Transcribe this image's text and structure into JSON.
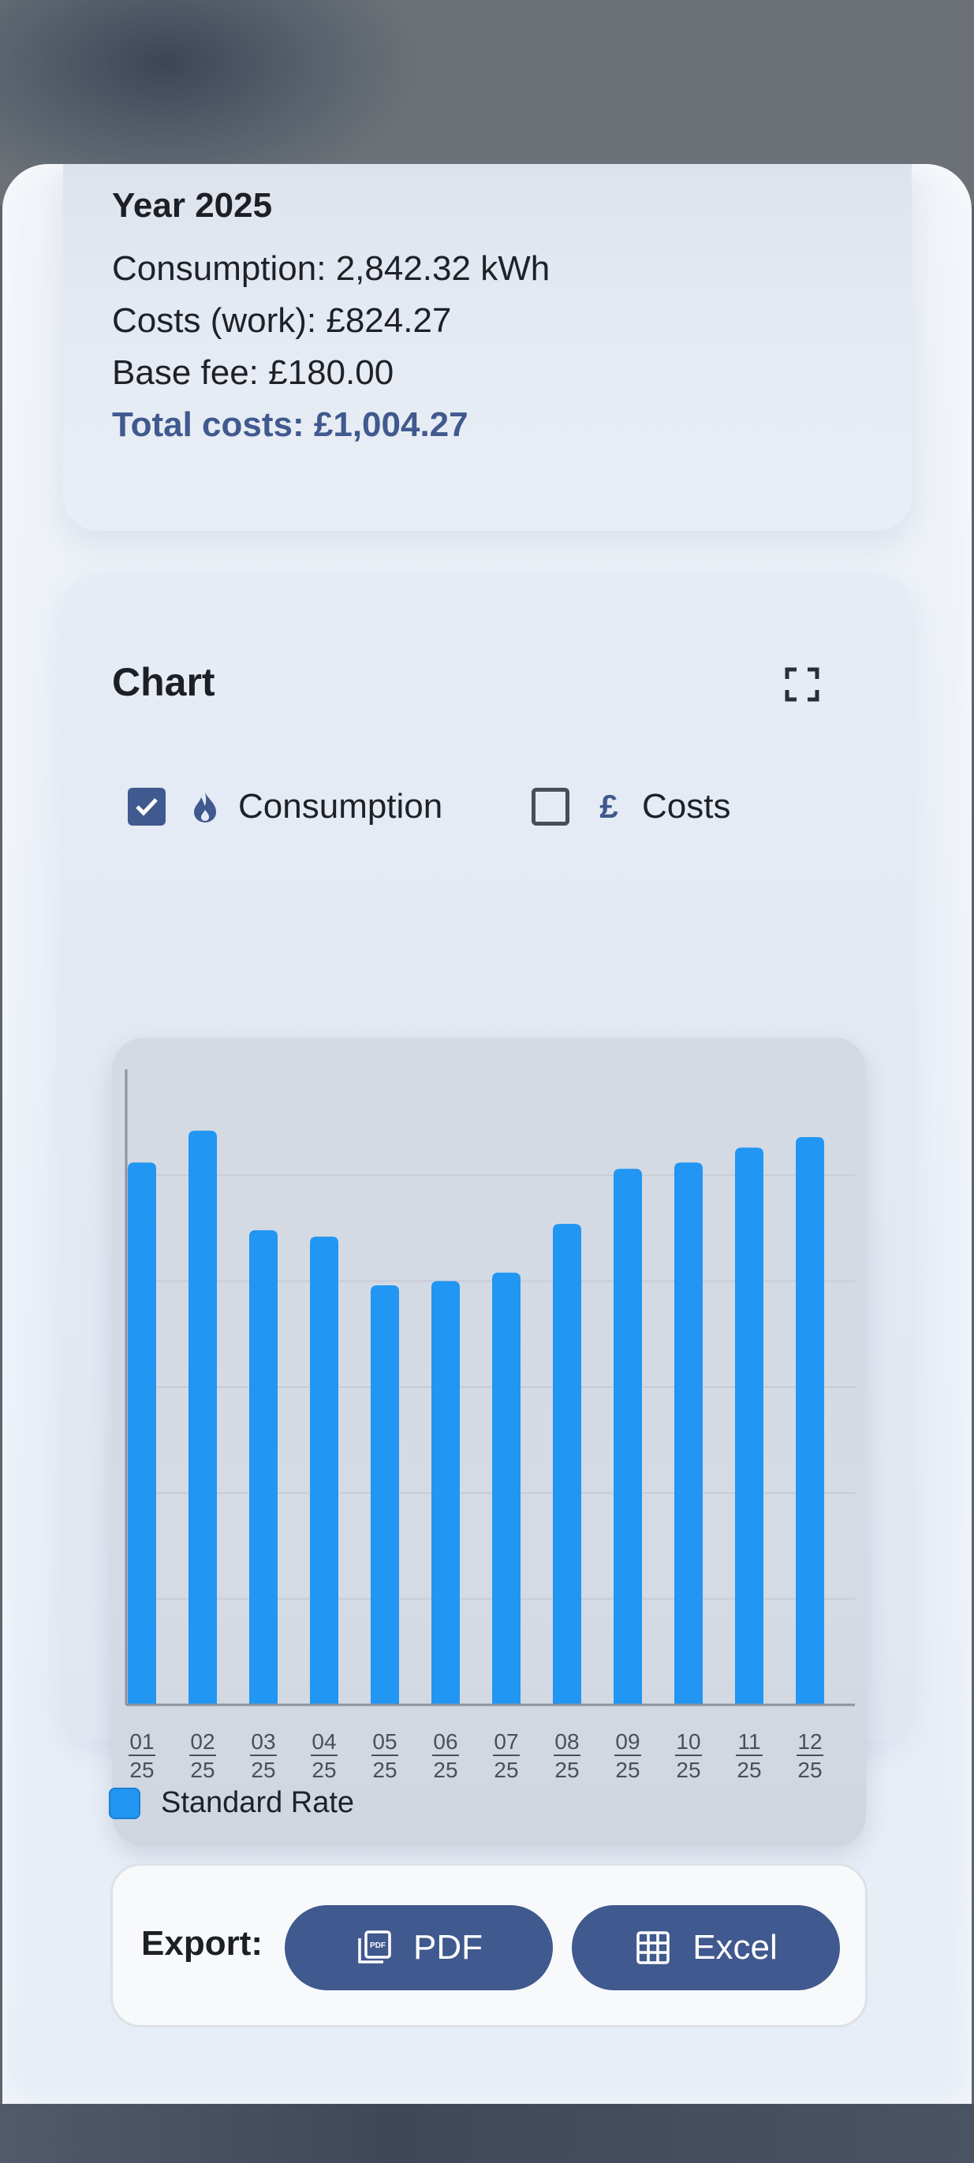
{
  "summary": {
    "title": "Year 2025",
    "consumption": "Consumption: 2,842.32 kWh",
    "costs_work": "Costs (work): £824.27",
    "base_fee": "Base fee: £180.00",
    "total_costs": "Total costs: £1,004.27"
  },
  "chart_section": {
    "title": "Chart",
    "expand_icon": "fullscreen-icon",
    "toggles": [
      {
        "label": "Consumption",
        "checked": true,
        "icon": "flame-icon"
      },
      {
        "label": "Costs",
        "checked": false,
        "icon": "pound-icon",
        "symbol": "£"
      }
    ]
  },
  "chart_data": {
    "type": "bar",
    "categories": [
      "01/25",
      "02/25",
      "03/25",
      "04/25",
      "05/25",
      "06/25",
      "07/25",
      "08/25",
      "09/25",
      "10/25",
      "11/25",
      "12/25"
    ],
    "tick_labels": [
      {
        "month": "01",
        "year": "25"
      },
      {
        "month": "02",
        "year": "25"
      },
      {
        "month": "03",
        "year": "25"
      },
      {
        "month": "04",
        "year": "25"
      },
      {
        "month": "05",
        "year": "25"
      },
      {
        "month": "06",
        "year": "25"
      },
      {
        "month": "07",
        "year": "25"
      },
      {
        "month": "08",
        "year": "25"
      },
      {
        "month": "09",
        "year": "25"
      },
      {
        "month": "10",
        "year": "25"
      },
      {
        "month": "11",
        "year": "25"
      },
      {
        "month": "12",
        "year": "25"
      }
    ],
    "series": [
      {
        "values": [
          256,
          271,
          224,
          221,
          198,
          200,
          204,
          227,
          253,
          256,
          263,
          268
        ],
        "color": "#2196f3"
      }
    ],
    "ylim": [
      0,
      300
    ],
    "gridlines": [
      50,
      100,
      150,
      200,
      250
    ],
    "grid": true,
    "xlabel": "",
    "ylabel": ""
  },
  "legend": {
    "label": "Standard Rate",
    "color": "#2196f3"
  },
  "export": {
    "label": "Export:",
    "pdf_label": "PDF",
    "excel_label": "Excel"
  },
  "colors": {
    "accent": "#40598e",
    "bar": "#2196f3"
  }
}
